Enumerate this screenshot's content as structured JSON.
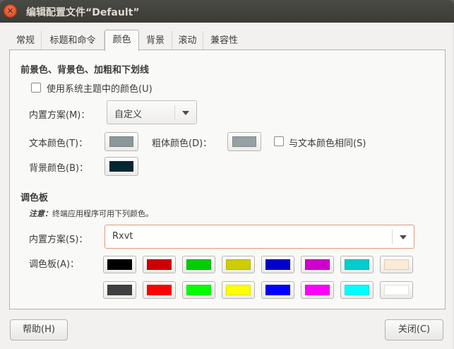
{
  "window": {
    "title": "编辑配置文件“Default”",
    "close_glyph": "✕"
  },
  "tabs": [
    {
      "label": "常规"
    },
    {
      "label": "标题和命令"
    },
    {
      "label": "颜色"
    },
    {
      "label": "背景"
    },
    {
      "label": "滚动"
    },
    {
      "label": "兼容性"
    }
  ],
  "active_tab": "颜色",
  "fg_section": {
    "heading": "前景色、背景色、加粗和下划线",
    "use_system_theme_label": "使用系统主题中的颜色(U)",
    "use_system_theme_checked": false,
    "builtin_scheme_label": "内置方案(M)：",
    "builtin_scheme_value": "自定义",
    "text_color_label": "文本颜色(T)：",
    "text_color": "#8a989c",
    "bold_color_label": "粗体颜色(D)：",
    "bold_color": "#95a1a2",
    "same_as_text_label": "与文本颜色相同(S)",
    "same_as_text_checked": false,
    "bg_color_label": "背景颜色(B)：",
    "bg_color": "#052733"
  },
  "palette_section": {
    "heading": "调色板",
    "note_prefix": "注意：",
    "note_text": "终端应用程序可用下列颜色。",
    "builtin_scheme_label": "内置方案(S)：",
    "builtin_scheme_value": "Rxvt",
    "palette_label": "调色板(A)：",
    "colors_row1": [
      "#000000",
      "#cd0000",
      "#00cd00",
      "#cdcd00",
      "#0000cd",
      "#cd00cd",
      "#00cdcd",
      "#faebd7"
    ],
    "colors_row2": [
      "#404040",
      "#ff0000",
      "#00ff00",
      "#ffff00",
      "#0000ff",
      "#ff00ff",
      "#00ffff",
      "#ffffff"
    ]
  },
  "footer": {
    "help_label": "帮助(H)",
    "close_label": "关闭(C)"
  }
}
